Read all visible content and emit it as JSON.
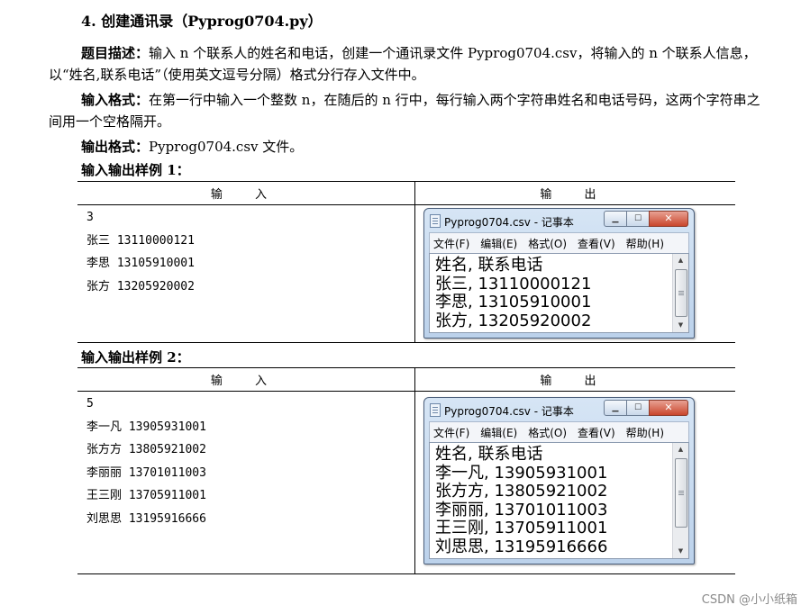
{
  "title": "4. 创建通讯录（Pyprog0704.py）",
  "description": {
    "label": "题目描述：",
    "text": "输入 n 个联系人的姓名和电话，创建一个通讯录文件 Pyprog0704.csv，将输入的 n 个联系人信息，以“姓名,联系电话”（使用英文逗号分隔）格式分行存入文件中。"
  },
  "input_format": {
    "label": "输入格式：",
    "text": "在第一行中输入一个整数 n，在随后的 n 行中，每行输入两个字符串姓名和电话号码，这两个字符串之间用一个空格隔开。"
  },
  "output_format": {
    "label": "输出格式：",
    "text": "Pyprog0704.csv 文件。"
  },
  "samples": [
    {
      "heading": "输入输出样例 1：",
      "col_input": "输 入",
      "col_output": "输 出",
      "input_lines": [
        "3",
        "张三 13110000121",
        "李思 13105910001",
        "张方 13205920002"
      ],
      "window": {
        "title": "Pyprog0704.csv - 记事本",
        "menu": [
          "文件(F)",
          "编辑(E)",
          "格式(O)",
          "查看(V)",
          "帮助(H)"
        ],
        "content": "姓名, 联系电话\n张三, 13110000121\n李思, 13105910001\n张方, 13205920002"
      }
    },
    {
      "heading": "输入输出样例 2：",
      "col_input": "输 入",
      "col_output": "输 出",
      "input_lines": [
        "5",
        "李一凡 13905931001",
        "张方方 13805921002",
        "李丽丽 13701011003",
        "王三刚 13705911001",
        "刘思思 13195916666"
      ],
      "window": {
        "title": "Pyprog0704.csv - 记事本",
        "menu": [
          "文件(F)",
          "编辑(E)",
          "格式(O)",
          "查看(V)",
          "帮助(H)"
        ],
        "content": "姓名, 联系电话\n李一凡, 13905931001\n张方方, 13805921002\n李丽丽, 13701011003\n王三刚, 13705911001\n刘思思, 13195916666"
      }
    }
  ],
  "watermark": "CSDN @小小纸箱"
}
